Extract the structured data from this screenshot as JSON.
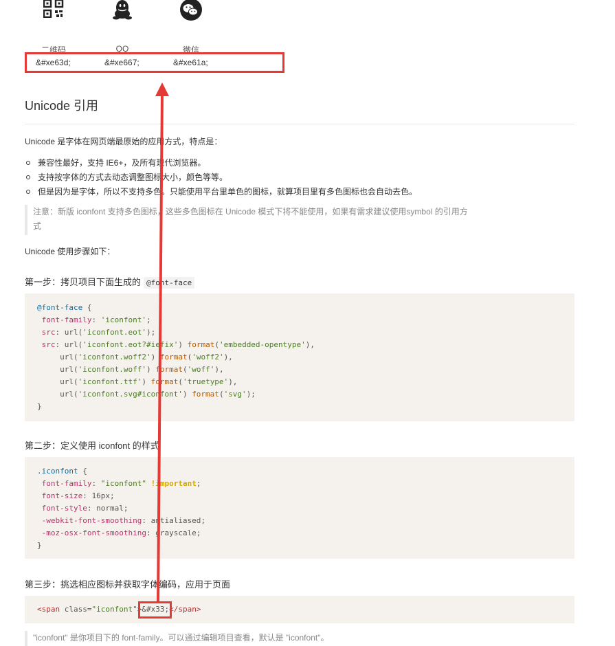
{
  "icons": [
    {
      "name": "qrcode-icon",
      "label": "二维码",
      "code": "&#xe63d;"
    },
    {
      "name": "qq-icon",
      "label": "QQ",
      "code": "&#xe667;"
    },
    {
      "name": "wechat-icon",
      "label": "微信",
      "code": "&#xe61a;"
    }
  ],
  "section": {
    "title": "Unicode 引用",
    "intro": "Unicode 是字体在网页端最原始的应用方式，特点是：",
    "bullets": [
      "兼容性最好，支持 IE6+，及所有现代浏览器。",
      "支持按字体的方式去动态调整图标大小，颜色等等。",
      "但是因为是字体，所以不支持多色。只能使用平台里单色的图标，就算项目里有多色图标也会自动去色。"
    ],
    "note_line1": "注意：新版 iconfont 支持多色图标，这些多色图标在 Unicode 模式下将不能使用，如果有需求建议使用symbol 的引用方",
    "note_line2": "式",
    "steps_intro": "Unicode 使用步骤如下："
  },
  "step1": {
    "label": "第一步：拷贝项目下面生成的",
    "code_inline": "@font-face",
    "code": {
      "l1_kw": "@font-face",
      "l1_rest": " {",
      "l2_prop": "font-family",
      "l2_val": "'iconfont'",
      "l3_prop": "src",
      "l3_fn": "url",
      "l3_val": "'iconfont.eot'",
      "l4_prop": "src",
      "l4_val": "'iconfont.eot?#iefix'",
      "l4_fmt": "'embedded-opentype'",
      "l5_val": "'iconfont.woff2'",
      "l5_fmt": "'woff2'",
      "l6_val": "'iconfont.woff'",
      "l6_fmt": "'woff'",
      "l7_val": "'iconfont.ttf'",
      "l7_fmt": "'truetype'",
      "l8_val": "'iconfont.svg#iconfont'",
      "l8_fmt": "'svg'",
      "l9": "}"
    }
  },
  "step2": {
    "label": "第二步：定义使用 iconfont 的样式",
    "code": {
      "selector": ".iconfont",
      "open": " {",
      "p1": "font-family",
      "v1": "\"iconfont\"",
      "imp": "!important",
      "p2": "font-size",
      "v2": "16px",
      "p3": "font-style",
      "v3": "normal",
      "p4": "-webkit-font-smoothing",
      "v4": "antialiased",
      "p5": "-moz-osx-font-smoothing",
      "v5": "grayscale",
      "close": "}"
    }
  },
  "step3": {
    "label": "第三步：挑选相应图标并获取字体编码，应用于页面",
    "code": {
      "open_tag": "<span",
      "attr": " class=",
      "attr_val": "\"iconfont\"",
      "gt": ">",
      "entity": "&#x33;",
      "close_tag": "</span>"
    }
  },
  "final_note": "\"iconfont\" 是你项目下的 font-family。可以通过编辑项目查看，默认是 \"iconfont\"。",
  "colors": {
    "annotation_red": "#e53935",
    "code_bg": "#f5f2ee"
  }
}
